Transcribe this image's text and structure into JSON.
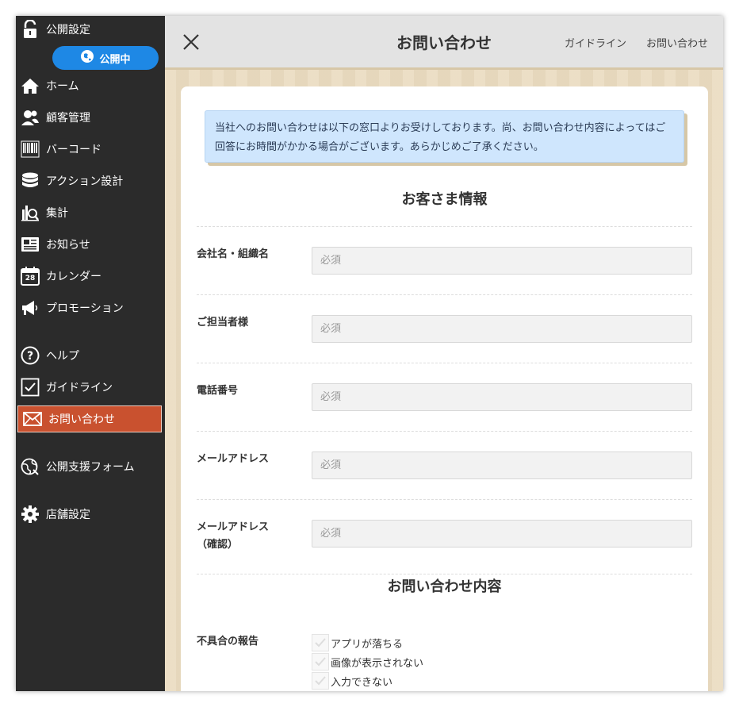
{
  "sidebar": {
    "publish_setting": "公開設定",
    "publish_status": "公開中",
    "items": [
      {
        "label": "ホーム",
        "icon": "home-icon"
      },
      {
        "label": "顧客管理",
        "icon": "users-icon"
      },
      {
        "label": "バーコード",
        "icon": "barcode-icon"
      },
      {
        "label": "アクション設計",
        "icon": "database-icon"
      },
      {
        "label": "集計",
        "icon": "chart-icon"
      },
      {
        "label": "お知らせ",
        "icon": "newspaper-icon"
      },
      {
        "label": "カレンダー",
        "icon": "calendar-icon"
      },
      {
        "label": "プロモーション",
        "icon": "megaphone-icon"
      },
      {
        "label": "ヘルプ",
        "icon": "help-icon"
      },
      {
        "label": "ガイドライン",
        "icon": "checkbox-icon"
      },
      {
        "label": "お問い合わせ",
        "icon": "mail-icon"
      },
      {
        "label": "公開支援フォーム",
        "icon": "globe-icon"
      },
      {
        "label": "店舗設定",
        "icon": "gear-icon"
      }
    ],
    "calendar_day": "28"
  },
  "header": {
    "title": "お問い合わせ",
    "links": [
      "ガイドライン",
      "お問い合わせ"
    ]
  },
  "notice": "当社へのお問い合わせは以下の窓口よりお受けしております。尚、お問い合わせ内容によってはご回答にお時間がかかる場合がございます。あらかじめご了承ください。",
  "sections": {
    "customer_info": "お客さま情報",
    "inquiry": "お問い合わせ内容"
  },
  "fields": [
    {
      "label": "会社名・組織名",
      "placeholder": "必須"
    },
    {
      "label": "ご担当者様",
      "placeholder": "必須"
    },
    {
      "label": "電話番号",
      "placeholder": "必須"
    },
    {
      "label": "メールアドレス",
      "placeholder": "必須"
    },
    {
      "label": "メールアドレス",
      "sublabel": "（確認）",
      "placeholder": "必須"
    }
  ],
  "defect": {
    "label": "不具合の報告",
    "options": [
      "アプリが落ちる",
      "画像が表示されない",
      "入力できない"
    ]
  },
  "colors": {
    "sidebar_bg": "#2b2b2b",
    "active_bg": "#c9512f",
    "publish_blue": "#1e88e5",
    "notice_bg": "#cfe6fd"
  }
}
